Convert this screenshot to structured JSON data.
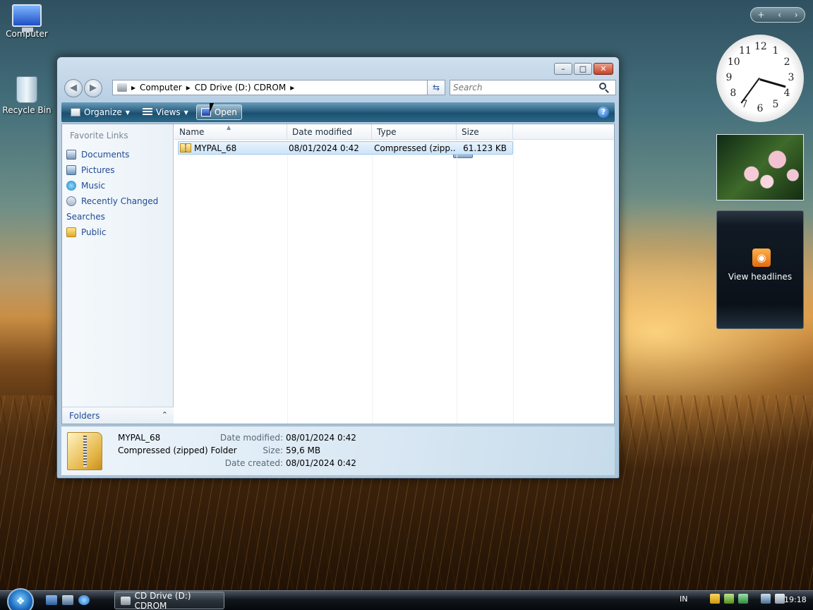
{
  "desktop": {
    "icons": [
      {
        "label": "Computer"
      },
      {
        "label": "Recycle Bin"
      }
    ]
  },
  "window": {
    "title": "CD Drive (D:) CDROM",
    "caption": {
      "minimize": "–",
      "maximize": "□",
      "close": "✕"
    },
    "nav": {
      "back": "◀",
      "forward": "▶"
    },
    "address": {
      "segments": [
        "Computer",
        "CD Drive (D:) CDROM"
      ],
      "separator": "▸"
    },
    "search": {
      "placeholder": "Search"
    },
    "toolbar": {
      "organize": "Organize",
      "views": "Views",
      "open": "Open",
      "help": "?"
    },
    "nav_pane": {
      "title": "Favorite Links",
      "links": [
        "Documents",
        "Pictures",
        "Music",
        "Recently Changed",
        "Searches",
        "Public"
      ],
      "folders_label": "Folders",
      "folders_chevron": "⌃"
    },
    "columns": [
      "Name",
      "Date modified",
      "Type",
      "Size"
    ],
    "files": [
      {
        "name": "MYPAL_68",
        "date_modified": "08/01/2024 0:42",
        "type": "Compressed (zipp...",
        "size": "61.123 KB"
      }
    ],
    "details": {
      "name": "MYPAL_68",
      "type": "Compressed (zipped) Folder",
      "props": [
        {
          "key": "Date modified:",
          "value": "08/01/2024 0:42"
        },
        {
          "key": "Size:",
          "value": "59,6 MB"
        },
        {
          "key": "Date created:",
          "value": "08/01/2024 0:42"
        }
      ]
    }
  },
  "sidebar": {
    "controls": {
      "add": "+",
      "prev": "‹",
      "next": "›"
    },
    "clock_numbers": [
      "12",
      "1",
      "2",
      "3",
      "4",
      "5",
      "6",
      "7",
      "8",
      "9",
      "10",
      "11"
    ],
    "feed_label": "View headlines"
  },
  "taskbar": {
    "task_label": "CD Drive (D:) CDROM",
    "language": "IN",
    "time": "19:18"
  }
}
